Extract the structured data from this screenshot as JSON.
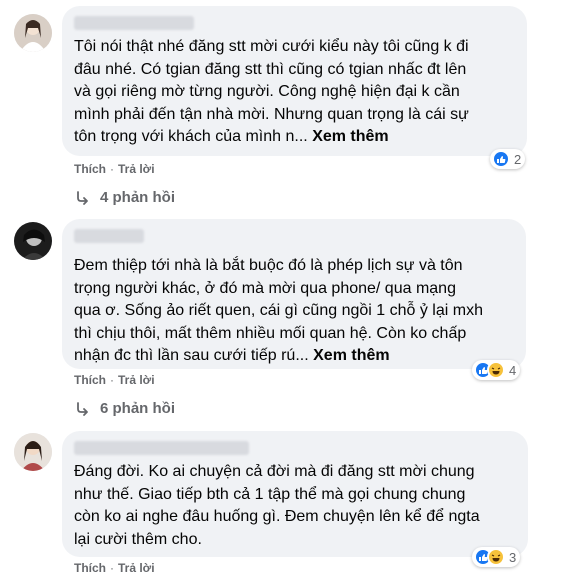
{
  "comments": [
    {
      "text_lines": [
        "Tôi nói thật nhé đăng stt mời cưới kiểu này tôi cũng k đi",
        "đâu nhé. Có tgian đăng stt thì cũng có tgian nhấc đt lên",
        "và gọi riêng mờ từng người. Công nghệ hiện đại k cần",
        "mình phải đến tận nhà mời. Nhưng quan trọng là cái sự",
        "tôn trọng với khách của mình n..."
      ],
      "see_more": "Xem thêm",
      "like_label": "Thích",
      "reply_label": "Trả lời",
      "reaction_count": "2",
      "reaction_types": [
        "like-icon"
      ],
      "replies_label": "4 phản hồi"
    },
    {
      "text_lines": [
        "Đem thiệp tới nhà là bắt buộc đó là phép lịch sự và tôn",
        "trọng người khác, ở đó mà mời qua phone/ qua mạng",
        "qua ơ. Sống ảo riết quen, cái gì cũng ngồi 1 chỗ ỷ lại mxh",
        "thì chịu thôi, mất thêm nhiều mối quan hệ. Còn ko chấp",
        "nhận đc thì lần sau cưới tiếp rú..."
      ],
      "see_more": "Xem thêm",
      "like_label": "Thích",
      "reply_label": "Trả lời",
      "reaction_count": "4",
      "reaction_types": [
        "like-icon",
        "haha-icon"
      ],
      "replies_label": "6 phản hồi"
    },
    {
      "text_lines": [
        "Đáng đời. Ko ai chuyện cả đời mà đi đăng stt mời chung",
        "như thế. Giao tiếp bth cả 1 tập thể mà gọi chung chung",
        "còn ko ai nghe đâu huống gì. Đem chuyện lên kể để ngta",
        "lại cười thêm cho."
      ],
      "see_more": "",
      "like_label": "Thích",
      "reply_label": "Trả lời",
      "reaction_count": "3",
      "reaction_types": [
        "like-icon",
        "haha-icon"
      ],
      "replies_label": ""
    }
  ],
  "colors": {
    "bubble": "#f0f2f5",
    "secondary_text": "#65676b",
    "like_blue": "#1877f2",
    "haha_yellow": "#f7c23b"
  }
}
